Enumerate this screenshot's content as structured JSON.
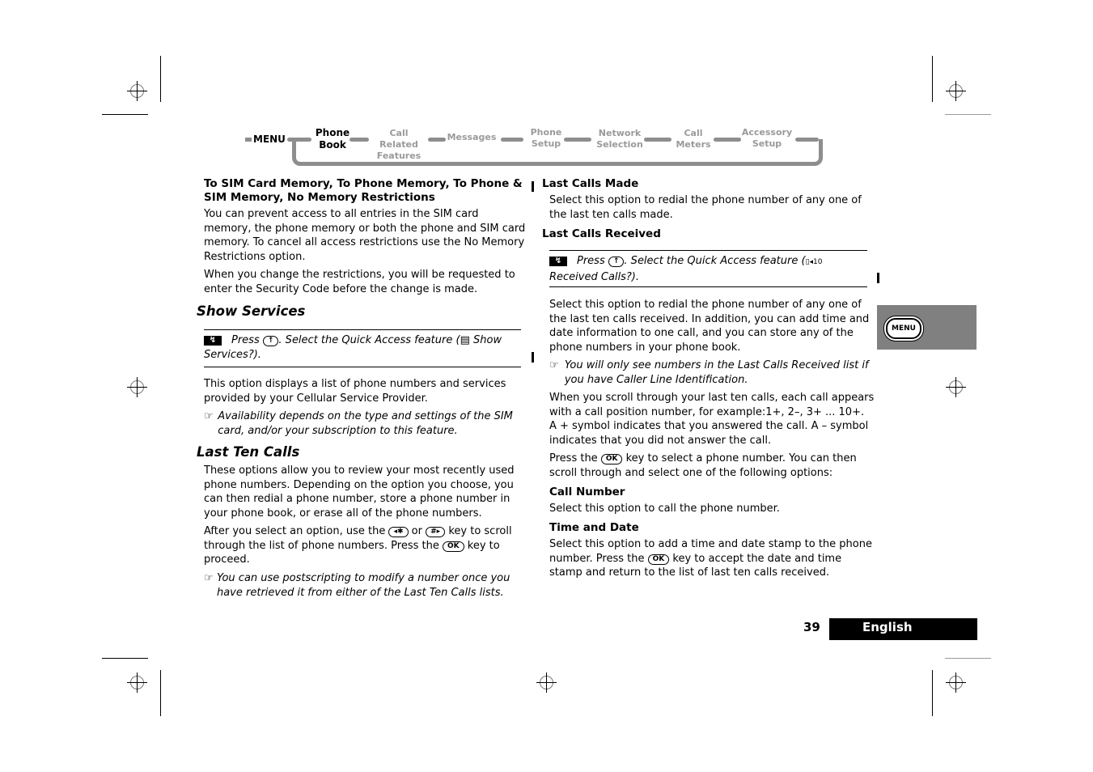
{
  "navigation": {
    "menu_label": "MENU",
    "items": [
      {
        "line1": "Phone",
        "line2": "Book",
        "active": true
      },
      {
        "line1": "Call Related",
        "line2": "Features",
        "active": false
      },
      {
        "line1": "Messages",
        "line2": "",
        "active": false
      },
      {
        "line1": "Phone",
        "line2": "Setup",
        "active": false
      },
      {
        "line1": "Network",
        "line2": "Selection",
        "active": false
      },
      {
        "line1": "Call",
        "line2": "Meters",
        "active": false
      },
      {
        "line1": "Accessory",
        "line2": "Setup",
        "active": false
      }
    ]
  },
  "left_column": {
    "restrictions_heading": "To SIM Card Memory, To Phone Memory, To Phone & SIM Memory, No Memory Restrictions",
    "restrictions_p1": "You can prevent access to all entries in the SIM card memory, the phone memory or both the phone and SIM card memory. To cancel all access restrictions use the No Memory Restrictions option.",
    "restrictions_p2": "When you change the restrictions, you will be requested to enter the Security Code before the change is made.",
    "show_services_heading": "Show Services",
    "show_services_qa_press": "Press",
    "show_services_qa_key": "↑",
    "show_services_qa_text1": ". Select the Quick Access feature (",
    "show_services_qa_icon": "▤",
    "show_services_qa_text2": " Show Services?).",
    "show_services_p1": "This option displays a list of phone numbers and services provided by your Cellular Service Provider.",
    "show_services_note": "Availability depends on the type and settings of the SIM card, and/or your subscription to this feature.",
    "last_ten_heading": "Last Ten Calls",
    "last_ten_p1": "These options allow you to review your most recently used phone numbers. Depending on the option you choose, you can then redial a phone number, store a phone number in your phone book, or erase all of the phone numbers.",
    "last_ten_p2_a": "After you select an option, use the",
    "last_ten_key1": "◂✱",
    "last_ten_p2_b": "or",
    "last_ten_key2": "#▸",
    "last_ten_p2_c": "key to scroll through the list of phone numbers. Press the",
    "last_ten_key3": "OK",
    "last_ten_p2_d": "key to proceed.",
    "last_ten_note": "You can use postscripting to modify a number once you have retrieved it from either of the Last Ten Calls lists."
  },
  "right_column": {
    "made_heading": "Last Calls Made",
    "made_p": "Select this option to redial the phone number of any one of the last ten calls made.",
    "received_heading": "Last Calls Received",
    "received_qa_press": "Press",
    "received_qa_key": "↑",
    "received_qa_text1": ". Select the Quick Access feature (",
    "received_qa_icon": "▯◂10",
    "received_qa_text2": " Received Calls?).",
    "received_p1": "Select this option to redial the phone number of any one of the last ten calls received. In addition, you can add time and date information to one call, and you can store any of the phone numbers in your phone book.",
    "received_note": "You will only see numbers in the Last Calls Received list if you have Caller Line Identification.",
    "received_p2": "When you scroll through your last ten calls, each call appears with a call position number, for example:1+, 2–, 3+ ... 10+. A + symbol indicates that you answered the call. A –  symbol indicates that you did not answer the call.",
    "received_p3_a": "Press the",
    "received_p3_key": "OK",
    "received_p3_b": "key to select a phone number. You can then scroll through and select one of the following options:",
    "call_number_heading": "Call Number",
    "call_number_p": "Select this option to call the phone number.",
    "time_date_heading": "Time and Date",
    "time_date_p_a": "Select this option to add a time and date stamp to the phone number. Press the",
    "time_date_key": "OK",
    "time_date_p_b": "key to accept the date and time stamp and return to the list of last ten calls received."
  },
  "side_tab": {
    "key_label": "MENU",
    "color": "#808080"
  },
  "footer": {
    "page_number": "39",
    "language": "English"
  },
  "icons": {
    "quick_access": "↯",
    "note": "☞"
  }
}
